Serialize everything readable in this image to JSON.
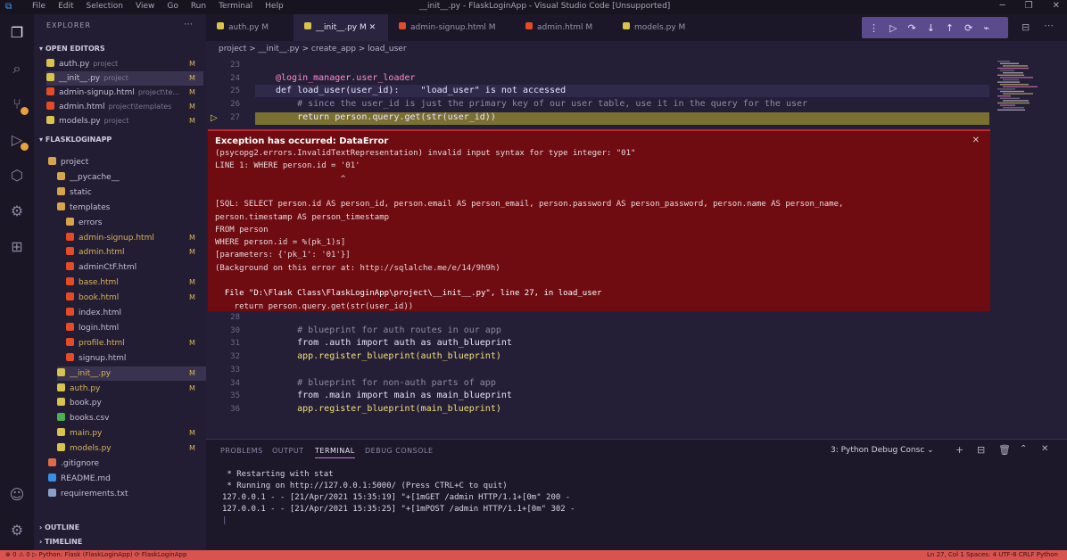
{
  "titlebar": {
    "menu": [
      "File",
      "Edit",
      "Selection",
      "View",
      "Go",
      "Run",
      "Terminal",
      "Help"
    ],
    "title": "__init__.py - FlaskLoginApp - Visual Studio Code [Unsupported]"
  },
  "sidebar": {
    "header": "EXPLORER",
    "open_editors_label": "OPEN EDITORS",
    "open_editors": [
      {
        "name": "auth.py",
        "path": "project",
        "status": "M",
        "color": "#d7c44c"
      },
      {
        "name": "__init__.py",
        "path": "project",
        "status": "M",
        "color": "#d7c44c"
      },
      {
        "name": "admin-signup.html",
        "path": "project\\te...",
        "status": "M",
        "color": "#e34c26"
      },
      {
        "name": "admin.html",
        "path": "project\\templates",
        "status": "M",
        "color": "#e34c26"
      },
      {
        "name": "models.py",
        "path": "project",
        "status": "M",
        "color": "#d7c44c"
      }
    ],
    "workspace_label": "FLASKLOGINAPP",
    "tree": [
      {
        "name": "project",
        "depth": 1,
        "kind": "folder",
        "status": ""
      },
      {
        "name": "__pycache__",
        "depth": 2,
        "kind": "folder",
        "status": ""
      },
      {
        "name": "static",
        "depth": 2,
        "kind": "folder",
        "status": ""
      },
      {
        "name": "templates",
        "depth": 2,
        "kind": "folder",
        "status": ""
      },
      {
        "name": "errors",
        "depth": 3,
        "kind": "folder",
        "status": ""
      },
      {
        "name": "admin-signup.html",
        "depth": 3,
        "kind": "html",
        "status": "M"
      },
      {
        "name": "admin.html",
        "depth": 3,
        "kind": "html",
        "status": "M"
      },
      {
        "name": "adminCtF.html",
        "depth": 3,
        "kind": "html",
        "status": ""
      },
      {
        "name": "base.html",
        "depth": 3,
        "kind": "html",
        "status": "M"
      },
      {
        "name": "book.html",
        "depth": 3,
        "kind": "html",
        "status": "M"
      },
      {
        "name": "index.html",
        "depth": 3,
        "kind": "html",
        "status": ""
      },
      {
        "name": "login.html",
        "depth": 3,
        "kind": "html",
        "status": ""
      },
      {
        "name": "profile.html",
        "depth": 3,
        "kind": "html",
        "status": "M"
      },
      {
        "name": "signup.html",
        "depth": 3,
        "kind": "html",
        "status": ""
      },
      {
        "name": "__init__.py",
        "depth": 2,
        "kind": "py",
        "status": "M"
      },
      {
        "name": "auth.py",
        "depth": 2,
        "kind": "py",
        "status": "M"
      },
      {
        "name": "book.py",
        "depth": 2,
        "kind": "py",
        "status": ""
      },
      {
        "name": "books.csv",
        "depth": 2,
        "kind": "csv",
        "status": ""
      },
      {
        "name": "main.py",
        "depth": 2,
        "kind": "py",
        "status": "M"
      },
      {
        "name": "models.py",
        "depth": 2,
        "kind": "py",
        "status": "M"
      },
      {
        "name": ".gitignore",
        "depth": 1,
        "kind": "git",
        "status": ""
      },
      {
        "name": "README.md",
        "depth": 1,
        "kind": "md",
        "status": ""
      },
      {
        "name": "requirements.txt",
        "depth": 1,
        "kind": "txt",
        "status": ""
      }
    ],
    "outline_label": "OUTLINE",
    "timeline_label": "TIMELINE"
  },
  "tabs": [
    {
      "label": "auth.py M",
      "color": "#d7c44c",
      "active": false
    },
    {
      "label": "__init__.py M",
      "color": "#d7c44c",
      "active": true
    },
    {
      "label": "admin-signup.html M",
      "color": "#e34c26",
      "active": false
    },
    {
      "label": "admin.html M",
      "color": "#e34c26",
      "active": false
    },
    {
      "label": "models.py M",
      "color": "#d7c44c",
      "active": false
    }
  ],
  "breadcrumb": "project > __init__.py > create_app > load_user",
  "editor": {
    "lines_top": [
      {
        "n": "23",
        "text": ""
      },
      {
        "n": "24",
        "text": "@login_manager.user_loader"
      },
      {
        "n": "25",
        "text": "def load_user(user_id):    \"load_user\" is not accessed"
      },
      {
        "n": "26",
        "text": "    # since the user_id is just the primary key of our user table, use it in the query for the user"
      },
      {
        "n": "27",
        "text": "    return person.query.get(str(user_id))"
      }
    ],
    "lines_bottom": [
      {
        "n": "28",
        "text": ""
      },
      {
        "n": "30",
        "text": "    # blueprint for auth routes in our app"
      },
      {
        "n": "31",
        "text": "    from .auth import auth as auth_blueprint"
      },
      {
        "n": "32",
        "text": "    app.register_blueprint(auth_blueprint)"
      },
      {
        "n": "33",
        "text": ""
      },
      {
        "n": "34",
        "text": "    # blueprint for non-auth parts of app"
      },
      {
        "n": "35",
        "text": "    from .main import main as main_blueprint"
      },
      {
        "n": "36",
        "text": "    app.register_blueprint(main_blueprint)"
      }
    ]
  },
  "exception": {
    "title": "Exception has occurred: DataError",
    "lines": [
      "(psycopg2.errors.InvalidTextRepresentation) invalid input syntax for type integer: \"01\"",
      "LINE 1: WHERE person.id = '01'",
      "                          ^",
      "",
      "[SQL: SELECT person.id AS person_id, person.email AS person_email, person.password AS person_password, person.name AS person_name,",
      "person.timestamp AS person_timestamp",
      "FROM person",
      "WHERE person.id = %(pk_1)s]",
      "[parameters: {'pk_1': '01'}]",
      "(Background on this error at: http://sqlalche.me/e/14/9h9h)",
      "",
      "  File \"D:\\Flask Class\\FlaskLoginApp\\project\\__init__.py\", line 27, in load_user",
      "    return person.query.get(str(user_id))"
    ]
  },
  "panel": {
    "tabs": [
      "PROBLEMS",
      "OUTPUT",
      "TERMINAL",
      "DEBUG CONSOLE"
    ],
    "active_tab": "TERMINAL",
    "terminal_select": "3: Python Debug Consc",
    "terminal": [
      " * Restarting with stat",
      " * Running on http://127.0.0.1:5000/ (Press CTRL+C to quit)",
      "127.0.0.1 - - [21/Apr/2021 15:35:19] \"+[1mGET /admin HTTP/1.1+[0m\" 200 -",
      "127.0.0.1 - - [21/Apr/2021 15:35:25] \"+[1mPOST /admin HTTP/1.1+[0m\" 302 -"
    ]
  },
  "statusbar": {
    "left": "⊗ 0 ⚠ 0   ▷ Python: Flask (FlaskLoginApp)   ⟳ FlaskLoginApp",
    "right": "Ln 27, Col 1   Spaces: 4   UTF-8   CRLF   Python"
  },
  "colors": {
    "accent": "#d07ad8",
    "exception_bg": "#6e0c12",
    "statusbar": "#d9534f",
    "current_line": "#7a7032"
  }
}
